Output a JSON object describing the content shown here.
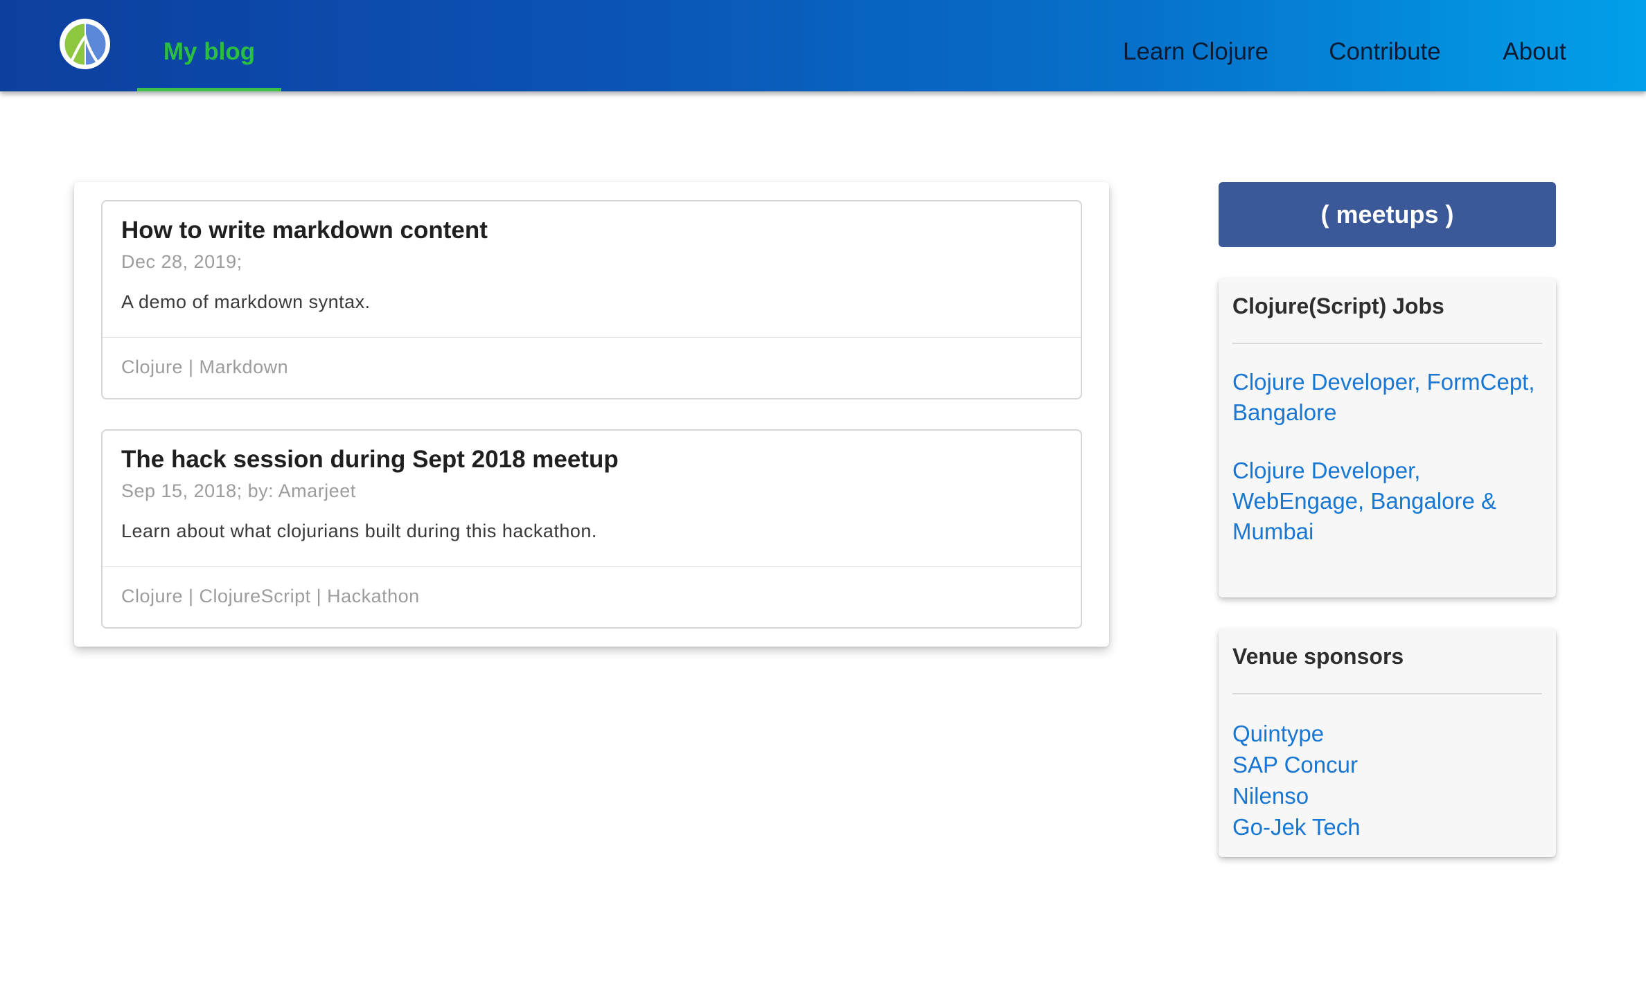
{
  "header": {
    "logo_icon": "clojure-logo-icon",
    "active_tab": "My blog",
    "nav_right": [
      "Learn Clojure",
      "Contribute",
      "About"
    ],
    "colors": {
      "gradient_start": "#0d3f9f",
      "gradient_end": "#02a0ea",
      "active_tab_text": "#2bbf3f"
    }
  },
  "posts": [
    {
      "title": "How to write markdown content",
      "meta": "Dec 28, 2019;",
      "summary": "A demo of markdown syntax.",
      "tags": "Clojure | Markdown"
    },
    {
      "title": "The hack session during Sept 2018 meetup",
      "meta": "Sep 15, 2018; by: Amarjeet",
      "summary": "Learn about what clojurians built during this hackathon.",
      "tags": "Clojure | ClojureScript | Hackathon"
    }
  ],
  "sidebar": {
    "meetups_label": "( meetups )",
    "meetups_color": "#3b5998",
    "jobs": {
      "heading": "Clojure(Script) Jobs",
      "items": [
        "Clojure Developer, FormCept, Bangalore",
        "Clojure Developer, WebEngage, Bangalore & Mumbai"
      ]
    },
    "sponsors": {
      "heading": "Venue sponsors",
      "items": [
        "Quintype",
        "SAP Concur",
        "Nilenso",
        "Go-Jek Tech"
      ]
    },
    "link_color": "#1877d3"
  }
}
